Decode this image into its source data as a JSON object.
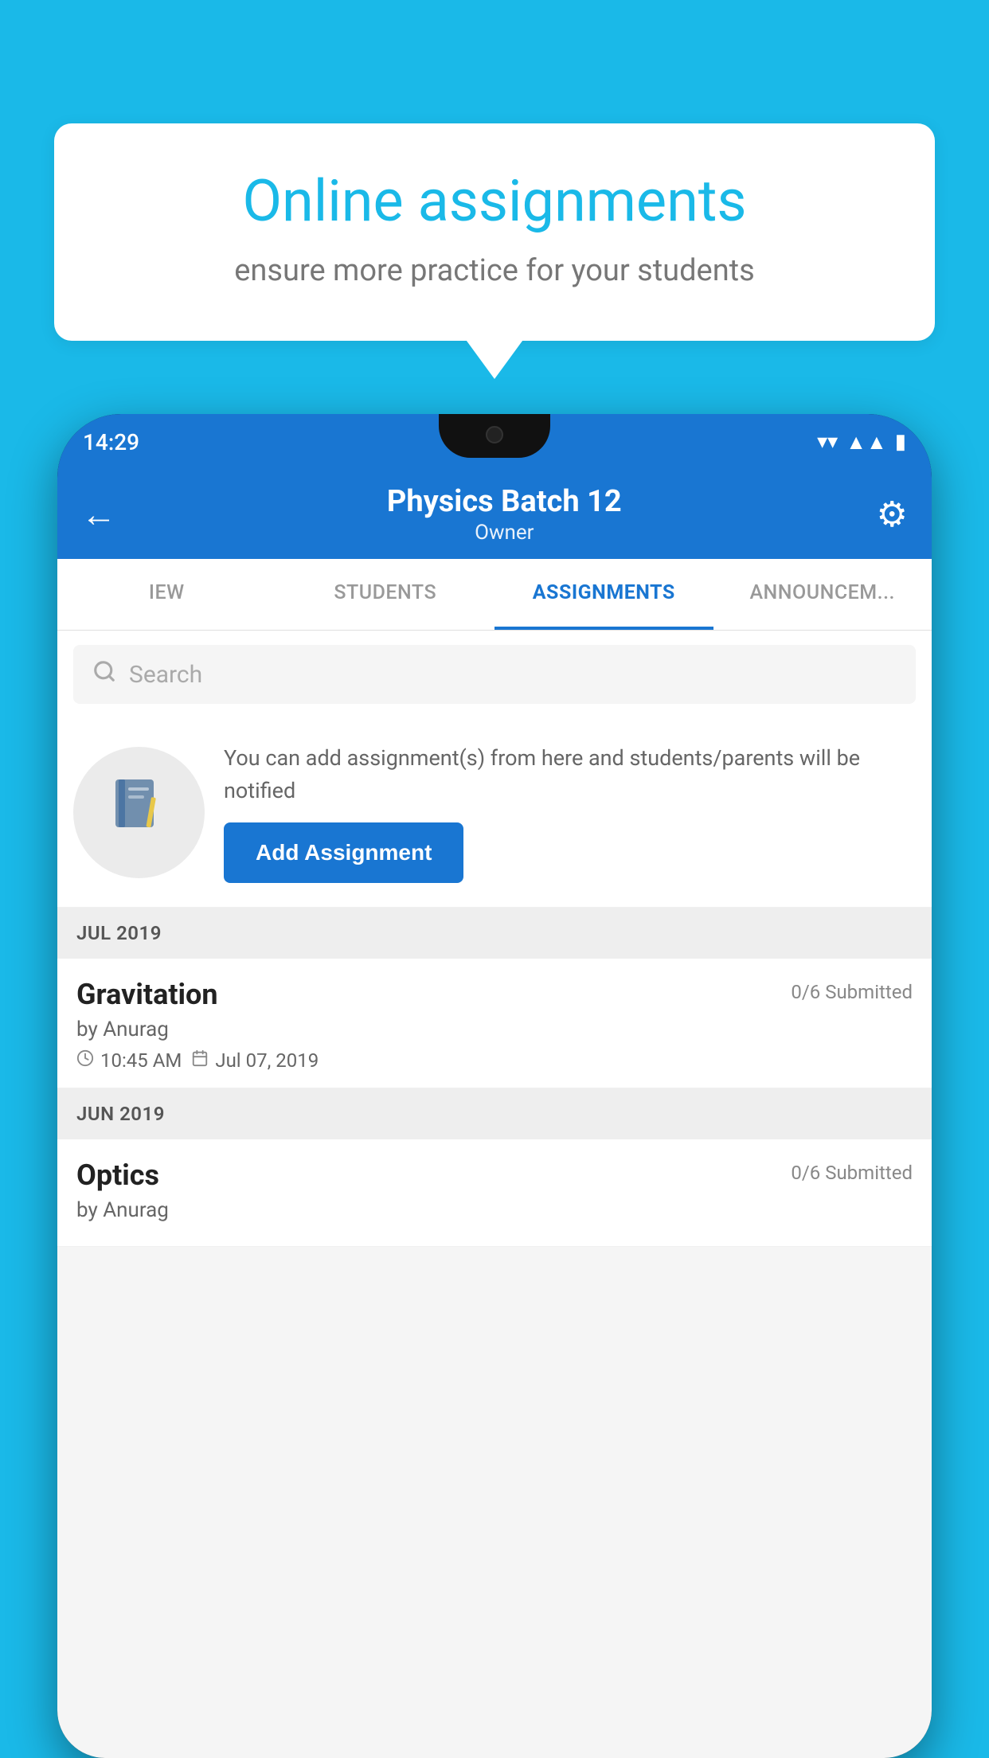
{
  "background_color": "#1ab9e8",
  "speech_bubble": {
    "title": "Online assignments",
    "subtitle": "ensure more practice for your students"
  },
  "phone": {
    "status_bar": {
      "time": "14:29",
      "wifi_icon": "wifi-icon",
      "signal_icon": "signal-icon",
      "battery_icon": "battery-icon"
    },
    "header": {
      "title": "Physics Batch 12",
      "subtitle": "Owner",
      "back_label": "←",
      "settings_label": "⚙"
    },
    "tabs": [
      {
        "label": "IEW",
        "active": false
      },
      {
        "label": "STUDENTS",
        "active": false
      },
      {
        "label": "ASSIGNMENTS",
        "active": true
      },
      {
        "label": "ANNOUNCEM...",
        "active": false
      }
    ],
    "search": {
      "placeholder": "Search"
    },
    "add_assignment": {
      "info_text": "You can add assignment(s) from here and students/parents will be notified",
      "button_label": "Add Assignment"
    },
    "sections": [
      {
        "header": "JUL 2019",
        "items": [
          {
            "name": "Gravitation",
            "submitted": "0/6 Submitted",
            "author": "by Anurag",
            "time": "10:45 AM",
            "date": "Jul 07, 2019"
          }
        ]
      },
      {
        "header": "JUN 2019",
        "items": [
          {
            "name": "Optics",
            "submitted": "0/6 Submitted",
            "author": "by Anurag",
            "time": "",
            "date": ""
          }
        ]
      }
    ]
  }
}
